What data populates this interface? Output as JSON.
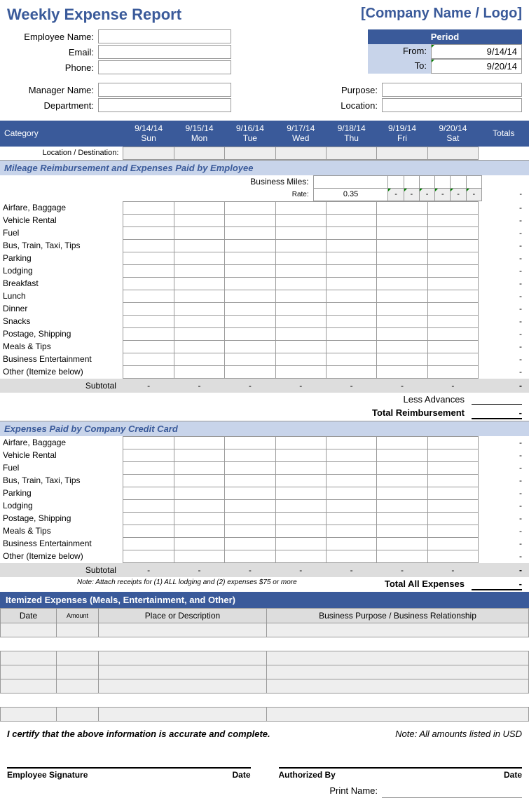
{
  "title": "Weekly Expense Report",
  "company": "[Company Name / Logo]",
  "labels": {
    "emp": "Employee Name:",
    "email": "Email:",
    "phone": "Phone:",
    "mgr": "Manager Name:",
    "dept": "Department:",
    "purpose": "Purpose:",
    "location": "Location:",
    "period": "Period",
    "from": "From:",
    "to": "To:",
    "category": "Category",
    "totals": "Totals",
    "loc": "Location / Destination:",
    "miles": "Business Miles:",
    "rate": "Rate:",
    "subtotal": "Subtotal",
    "less": "Less Advances",
    "totreimb": "Total Reimbursement",
    "totall": "Total All Expenses",
    "note": "Note:   Attach receipts for (1) ALL lodging and (2) expenses $75 or more",
    "cert": "I certify that the above information is accurate and complete.",
    "usd": "Note: All amounts listed in USD",
    "empsig": "Employee Signature",
    "date": "Date",
    "auth": "Authorized By",
    "prn": "Print Name:"
  },
  "period": {
    "from": "9/14/14",
    "to": "9/20/14"
  },
  "days": [
    {
      "d": "9/14/14",
      "w": "Sun"
    },
    {
      "d": "9/15/14",
      "w": "Mon"
    },
    {
      "d": "9/16/14",
      "w": "Tue"
    },
    {
      "d": "9/17/14",
      "w": "Wed"
    },
    {
      "d": "9/18/14",
      "w": "Thu"
    },
    {
      "d": "9/19/14",
      "w": "Fri"
    },
    {
      "d": "9/20/14",
      "w": "Sat"
    }
  ],
  "rate": "0.35",
  "sections": {
    "s1": "Mileage Reimbursement and Expenses Paid by Employee",
    "s2": "Expenses Paid by Company Credit Card",
    "s3": "Itemized Expenses (Meals, Entertainment, and Other)"
  },
  "rows1": [
    "Airfare, Baggage",
    "Vehicle Rental",
    "Fuel",
    "Bus, Train, Taxi, Tips",
    "Parking",
    "Lodging",
    "Breakfast",
    "Lunch",
    "Dinner",
    "Snacks",
    "Postage, Shipping",
    "Meals & Tips",
    "Business Entertainment",
    "Other (Itemize below)"
  ],
  "rows2": [
    "Airfare, Baggage",
    "Vehicle Rental",
    "Fuel",
    "Bus, Train, Taxi, Tips",
    "Parking",
    "Lodging",
    "Postage, Shipping",
    "Meals & Tips",
    "Business Entertainment",
    "Other (Itemize below)"
  ],
  "itemcols": {
    "date": "Date",
    "amt": "Amount",
    "place": "Place or Description",
    "purp": "Business Purpose / Business Relationship"
  },
  "dash": "-"
}
